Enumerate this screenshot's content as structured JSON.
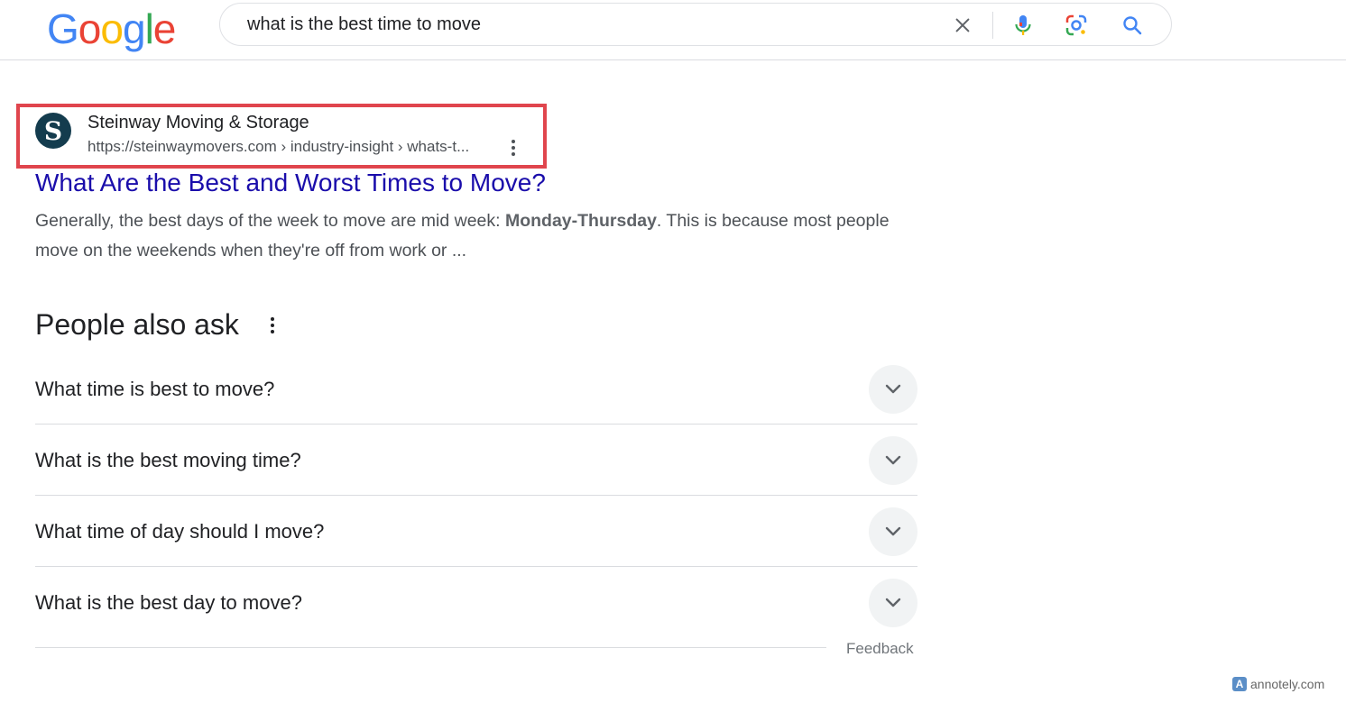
{
  "logo": {
    "letters": [
      {
        "ch": "G",
        "color": "#4285F4"
      },
      {
        "ch": "o",
        "color": "#EA4335"
      },
      {
        "ch": "o",
        "color": "#FBBC05"
      },
      {
        "ch": "g",
        "color": "#4285F4"
      },
      {
        "ch": "l",
        "color": "#34A853"
      },
      {
        "ch": "e",
        "color": "#EA4335"
      }
    ]
  },
  "search": {
    "query": "what is the best time to move",
    "icons": [
      "close-icon",
      "microphone-icon",
      "lens-icon",
      "search-icon"
    ]
  },
  "result": {
    "favicon_letter": "S",
    "site_name": "Steinway Moving & Storage",
    "url": "https://steinwaymovers.com › industry-insight › whats-t...",
    "title": "What Are the Best and Worst Times to Move?",
    "snippet_before": "Generally, the best days of the week to move are mid week: ",
    "snippet_bold": "Monday-Thursday",
    "snippet_after": ". This is because most people move on the weekends when they're off from work or ...",
    "highlight_color": "#e0454d"
  },
  "people_also_ask": {
    "title": "People also ask",
    "questions": [
      "What time is best to move?",
      "What is the best moving time?",
      "What time of day should I move?",
      "What is the best day to move?"
    ],
    "feedback": "Feedback"
  },
  "watermark": {
    "icon_letter": "A",
    "text": "annotely.com"
  },
  "colors": {
    "link": "#1a0dab",
    "text": "#202124",
    "muted": "#4d5156"
  }
}
